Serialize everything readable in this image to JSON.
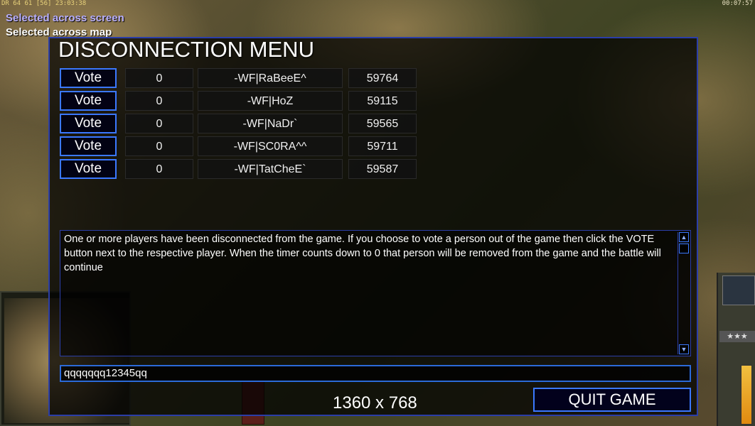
{
  "hud": {
    "top_left": "DR 64 61 [56] 23:03:38",
    "top_right": "00:07:57",
    "message_line1": "Selected across screen",
    "message_line2": "Selected across map",
    "rank_stars": "★★★"
  },
  "dialog": {
    "title": "DISCONNECTION MENU",
    "players": [
      {
        "vote_label": "Vote",
        "count": "0",
        "name": "-WF|RaBeeE^",
        "ping": "59764"
      },
      {
        "vote_label": "Vote",
        "count": "0",
        "name": "-WF|HoZ",
        "ping": "59115"
      },
      {
        "vote_label": "Vote",
        "count": "0",
        "name": "-WF|NaDr`",
        "ping": "59565"
      },
      {
        "vote_label": "Vote",
        "count": "0",
        "name": "-WF|SC0RA^^",
        "ping": "59711"
      },
      {
        "vote_label": "Vote",
        "count": "0",
        "name": "-WF|TatCheE`",
        "ping": "59587"
      }
    ],
    "info_text": "One or more players have been disconnected from the game. If you choose to vote a person out of the game then click the VOTE button next to the respective player. When the timer counts down to 0 that person will be removed from the game and the battle will continue",
    "chat_value": "qqqqqqq12345qq",
    "resolution": "1360 x 768",
    "quit_label": "QUIT GAME"
  }
}
